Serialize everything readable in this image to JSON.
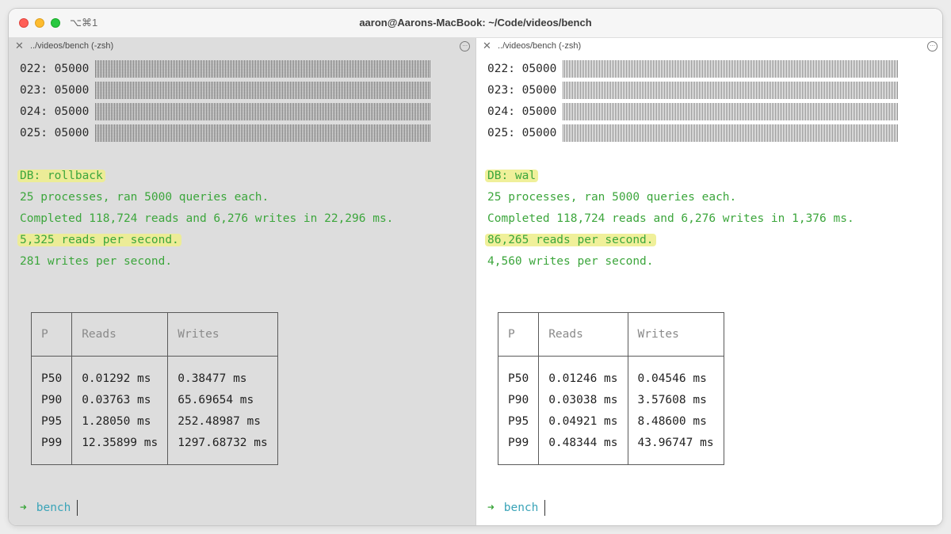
{
  "window": {
    "title": "aaron@Aarons-MacBook: ~/Code/videos/bench",
    "shortcut": "⌥⌘1"
  },
  "left": {
    "tab_title": "../videos/bench (-zsh)",
    "bar_rows": [
      {
        "label": "022: 05000"
      },
      {
        "label": "023: 05000"
      },
      {
        "label": "024: 05000"
      },
      {
        "label": "025: 05000"
      }
    ],
    "db_line": "DB: rollback",
    "processes_line": "25 processes, ran 5000 queries each.",
    "completed_line": "Completed 118,724 reads and 6,276 writes in 22,296 ms.",
    "reads_line": "5,325 reads per second.",
    "writes_line": "281 writes per second.",
    "table": {
      "headers": [
        "P",
        "Reads",
        "Writes"
      ],
      "rows": [
        [
          "P50",
          "0.01292 ms",
          "0.38477 ms"
        ],
        [
          "P90",
          "0.03763 ms",
          "65.69654 ms"
        ],
        [
          "P95",
          "1.28050 ms",
          "252.48987 ms"
        ],
        [
          "P99",
          "12.35899 ms",
          "1297.68732 ms"
        ]
      ]
    },
    "prompt_arrow": "➜",
    "prompt_dir": "bench"
  },
  "right": {
    "tab_title": "../videos/bench (-zsh)",
    "bar_rows": [
      {
        "label": "022: 05000"
      },
      {
        "label": "023: 05000"
      },
      {
        "label": "024: 05000"
      },
      {
        "label": "025: 05000"
      }
    ],
    "db_line": "DB: wal",
    "processes_line": "25 processes, ran 5000 queries each.",
    "completed_line": "Completed 118,724 reads and 6,276 writes in 1,376 ms.",
    "reads_line": "86,265 reads per second.",
    "writes_line": "4,560 writes per second.",
    "table": {
      "headers": [
        "P",
        "Reads",
        "Writes"
      ],
      "rows": [
        [
          "P50",
          "0.01246 ms",
          "0.04546 ms"
        ],
        [
          "P90",
          "0.03038 ms",
          "3.57608 ms"
        ],
        [
          "P95",
          "0.04921 ms",
          "8.48600 ms"
        ],
        [
          "P99",
          "0.48344 ms",
          "43.96747 ms"
        ]
      ]
    },
    "prompt_arrow": "➜",
    "prompt_dir": "bench"
  },
  "colors": {
    "green_text": "#3ca63c",
    "prompt_dir": "#3aa4b8",
    "highlight": "#f0f09a"
  }
}
